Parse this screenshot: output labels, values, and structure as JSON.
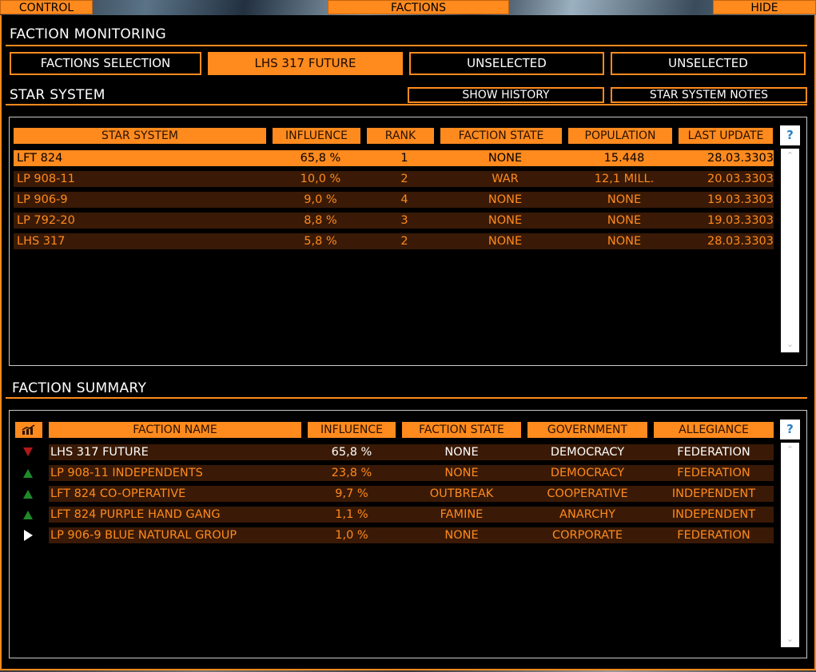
{
  "topbar": {
    "control": "CONTROL",
    "factions": "FACTIONS",
    "hide": "HIDE"
  },
  "monitoring": {
    "title": "FACTION MONITORING",
    "tabs": [
      "FACTIONS SELECTION",
      "LHS 317 FUTURE",
      "UNSELECTED",
      "UNSELECTED"
    ],
    "active_tab": 1
  },
  "star_system": {
    "title": "STAR SYSTEM",
    "show_history": "SHOW HISTORY",
    "notes": "STAR SYSTEM NOTES",
    "help": "?",
    "headers": [
      "STAR SYSTEM",
      "INFLUENCE",
      "RANK",
      "FACTION STATE",
      "POPULATION",
      "LAST UPDATE"
    ],
    "rows": [
      [
        "LFT 824",
        "65,8 %",
        "1",
        "NONE",
        "15.448",
        "28.03.3303"
      ],
      [
        "LP 908-11",
        "10,0 %",
        "2",
        "WAR",
        "12,1 MILL.",
        "20.03.3303"
      ],
      [
        "LP 906-9",
        "9,0 %",
        "4",
        "NONE",
        "NONE",
        "19.03.3303"
      ],
      [
        "LP 792-20",
        "8,8 %",
        "3",
        "NONE",
        "NONE",
        "19.03.3303"
      ],
      [
        "LHS 317",
        "5,8 %",
        "2",
        "NONE",
        "NONE",
        "28.03.3303"
      ]
    ],
    "selected_row": 0,
    "scroll_up": "⌃",
    "scroll_down": "⌄"
  },
  "summary": {
    "title": "FACTION SUMMARY",
    "help": "?",
    "headers": [
      "FACTION NAME",
      "INFLUENCE",
      "FACTION STATE",
      "GOVERNMENT",
      "ALLEGIANCE"
    ],
    "rows": [
      {
        "trend": "down",
        "name": "LHS 317 FUTURE",
        "influence": "65,8 %",
        "state": "NONE",
        "government": "DEMOCRACY",
        "allegiance": "FEDERATION"
      },
      {
        "trend": "up",
        "name": "LP 908-11 INDEPENDENTS",
        "influence": "23,8 %",
        "state": "NONE",
        "government": "DEMOCRACY",
        "allegiance": "FEDERATION"
      },
      {
        "trend": "up",
        "name": "LFT 824 CO-OPERATIVE",
        "influence": "9,7 %",
        "state": "OUTBREAK",
        "government": "COOPERATIVE",
        "allegiance": "INDEPENDENT"
      },
      {
        "trend": "up",
        "name": "LFT 824 PURPLE HAND GANG",
        "influence": "1,1 %",
        "state": "FAMINE",
        "government": "ANARCHY",
        "allegiance": "INDEPENDENT"
      },
      {
        "trend": "flat",
        "name": "LP 906-9 BLUE NATURAL GROUP",
        "influence": "1,0 %",
        "state": "NONE",
        "government": "CORPORATE",
        "allegiance": "FEDERATION"
      }
    ],
    "scroll_up": "⌃",
    "scroll_down": "⌄"
  },
  "colors": {
    "accent": "#ff8a1e",
    "row_bg": "#3a1a06",
    "trend_up": "#1f8a2a",
    "trend_down": "#b01818"
  }
}
